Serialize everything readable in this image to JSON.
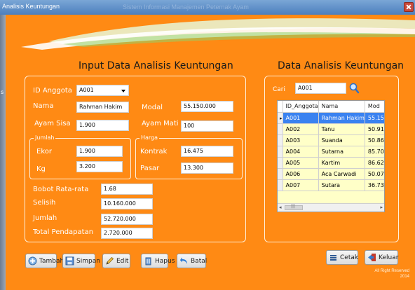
{
  "window": {
    "title": "Analisis Keuntungan",
    "background_title": "Sistem Informasi Manajemen Peternak Ayam",
    "edge_char": "s"
  },
  "colors": {
    "accent": "#ff8a14",
    "selected_row": "#3a82f0",
    "grid_row": "#ffffc8"
  },
  "form": {
    "heading": "Input Data Analisis Keuntungan",
    "id_anggota_label": "ID Anggota",
    "id_anggota_value": "A001",
    "nama_label": "Nama",
    "nama_value": "Rahman Hakim",
    "modal_label": "Modal",
    "modal_value": "55.150.000",
    "ayam_sisa_label": "Ayam Sisa",
    "ayam_sisa_value": "1.900",
    "ayam_mati_label": "Ayam Mati",
    "ayam_mati_value": "100",
    "jumlah_group_label": "Jumlah",
    "ekor_label": "Ekor",
    "ekor_value": "1.900",
    "kg_label": "Kg",
    "kg_value": "3.200",
    "harga_group_label": "Harga",
    "kontrak_label": "Kontrak",
    "kontrak_value": "16.475",
    "pasar_label": "Pasar",
    "pasar_value": "13.300",
    "bobot_label": "Bobot Rata-rata",
    "bobot_value": "1.68",
    "selisih_label": "Selisih",
    "selisih_value": "10.160.000",
    "jumlah_label": "Jumlah",
    "jumlah_value": "52.720.000",
    "total_label": "Total Pendapatan",
    "total_value": "2.720.000"
  },
  "data_panel": {
    "heading": "Data Analisis Keuntungan",
    "cari_label": "Cari",
    "search_value": "A001",
    "columns": [
      "ID_Anggota",
      "Nama",
      "Mod"
    ],
    "rows": [
      [
        "A001",
        "Rahman Hakim",
        "55.15"
      ],
      [
        "A002",
        "Tanu",
        "50.91"
      ],
      [
        "A003",
        "Suanda",
        "50.86"
      ],
      [
        "A004",
        "Sutarna",
        "85.70"
      ],
      [
        "A005",
        "Kartim",
        "86.62"
      ],
      [
        "A006",
        "Aca Carwadi",
        "50.07"
      ],
      [
        "A007",
        "Sutara",
        "36.73"
      ]
    ],
    "scroll_left": "◂",
    "scroll_right": "▸"
  },
  "buttons": {
    "tambah": "Tambah",
    "simpan": "Simpan",
    "edit": "Edit",
    "hapus": "Hapus",
    "batal": "Batal",
    "cetak": "Cetak",
    "keluar": "Keluar"
  },
  "footer": {
    "line1": "All Right Reserved",
    "line2": "2014"
  }
}
